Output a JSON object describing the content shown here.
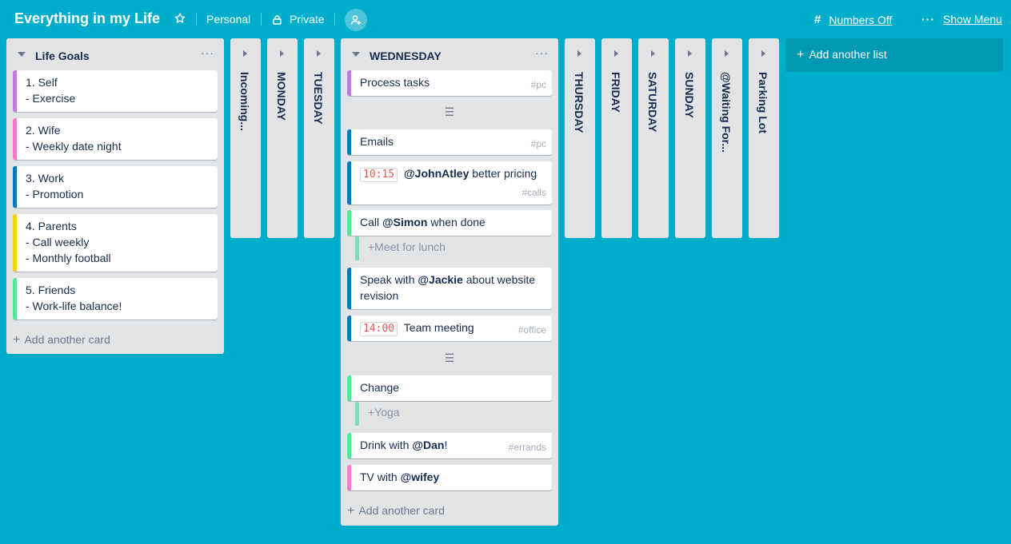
{
  "board": {
    "title": "Everything in my Life",
    "team": "Personal",
    "visibility": "Private",
    "numbers_toggle": "Numbers Off",
    "show_menu": "Show Menu",
    "icons": {
      "star": "star-icon",
      "lock": "lock-icon",
      "add_member": "add-member-icon",
      "hash": "hash-icon",
      "menu": "ellipsis-icon"
    }
  },
  "colors": {
    "background": "#00aecc",
    "purple": "#c377e0",
    "pink": "#ff78cb",
    "blue": "#0079bf",
    "yellow": "#f2d600",
    "green": "#61bd4f",
    "mint": "#51e898",
    "time_red": "#eb5a46"
  },
  "life_goals": {
    "title": "Life Goals",
    "cards": [
      {
        "line1": "1. Self",
        "line2": "- Exercise",
        "color": "#c377e0"
      },
      {
        "line1": "2. Wife",
        "line2": "- Weekly date night",
        "color": "#ff78cb"
      },
      {
        "line1": "3. Work",
        "line2": "- Promotion",
        "color": "#0079bf"
      },
      {
        "line1": "4. Parents",
        "line2": "- Call weekly",
        "line3": "- Monthly football",
        "color": "#f2d600"
      },
      {
        "line1": "5. Friends",
        "line2": "- Work-life balance!",
        "color": "#51e898"
      }
    ],
    "add_card": "Add another card"
  },
  "collapsed_lists": [
    "Incoming...",
    "MONDAY",
    "TUESDAY",
    "THURSDAY",
    "FRIDAY",
    "SATURDAY",
    "SUNDAY",
    "@Waiting For...",
    "Parking Lot"
  ],
  "wednesday": {
    "title": "WEDNESDAY",
    "separator": "☰",
    "cards": {
      "process": {
        "text": "Process tasks",
        "tag": "#pc"
      },
      "emails": {
        "text": "Emails",
        "tag": "#pc"
      },
      "john": {
        "time": "10:15",
        "mention": "@JohnAtley",
        "text": " better pricing",
        "tag": "#calls"
      },
      "simon": {
        "pre": "Call ",
        "mention": "@Simon",
        "text": " when done"
      },
      "simon_sub": "+Meet for lunch",
      "jackie": {
        "pre": "Speak with ",
        "mention": "@Jackie",
        "text": " about website revision"
      },
      "meeting": {
        "time": "14:00",
        "text": "Team meeting",
        "tag": "#office"
      },
      "change": {
        "text": "Change"
      },
      "change_sub": "+Yoga",
      "dan": {
        "pre": "Drink with ",
        "mention": "@Dan",
        "text": "!",
        "tag": "#errands"
      },
      "wifey": {
        "pre": "TV with ",
        "mention": "@wifey"
      }
    },
    "add_card": "Add another card"
  },
  "add_list": "Add another list"
}
